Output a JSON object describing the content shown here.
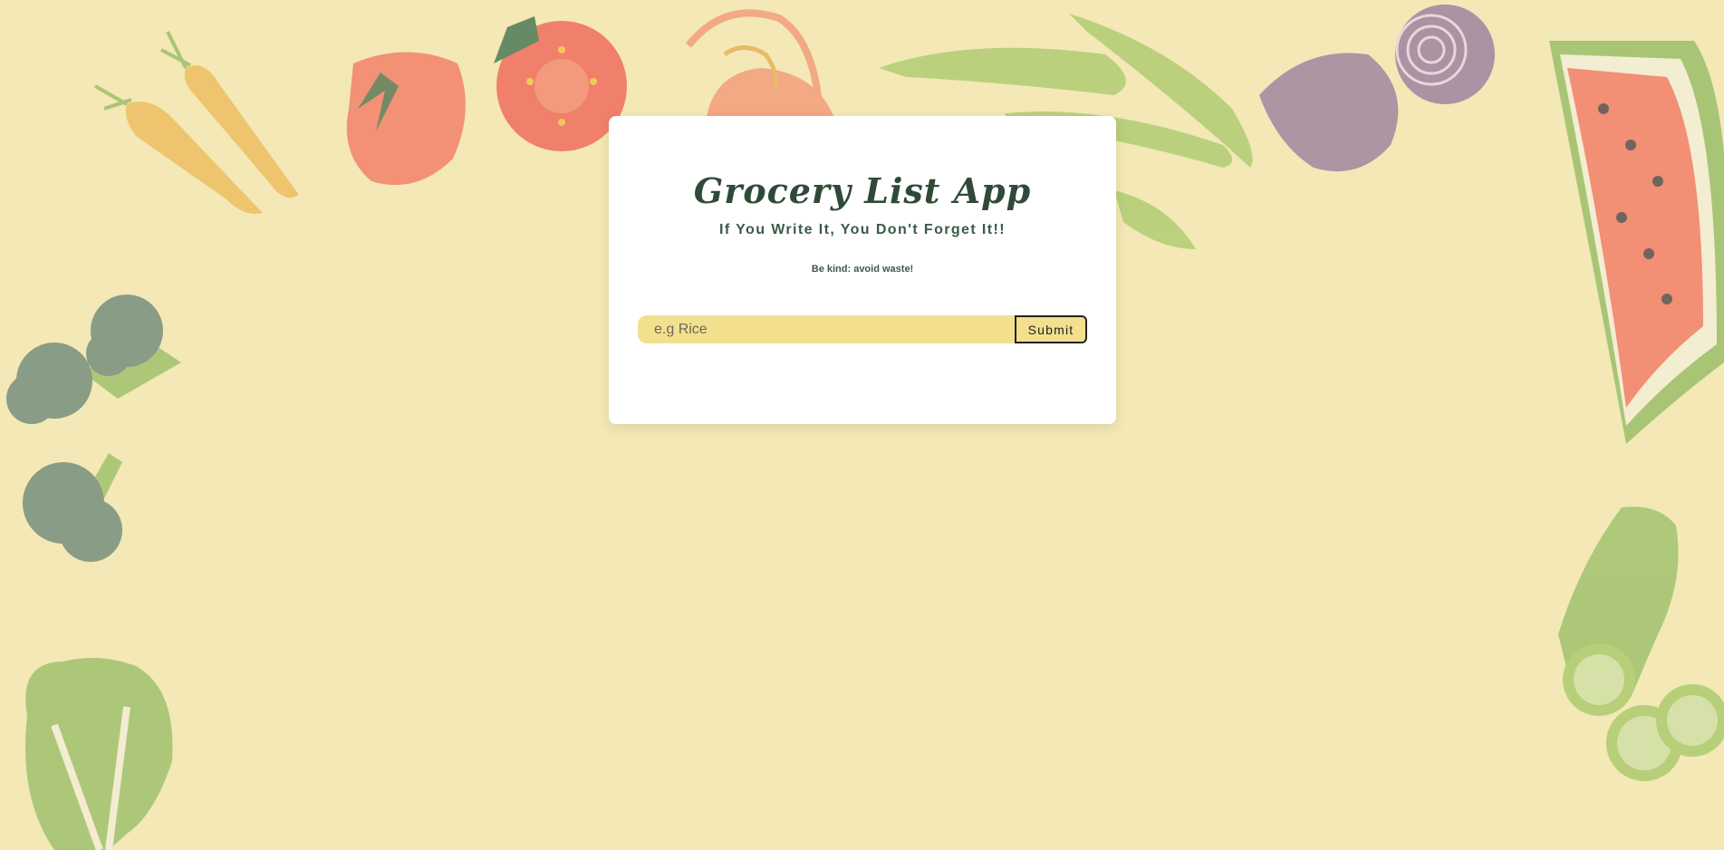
{
  "app": {
    "title": "Grocery List App",
    "subtitle": "If You Write It, You Don't Forget It!!",
    "note": "Be kind: avoid waste!"
  },
  "form": {
    "input_value": "",
    "input_placeholder": "e.g Rice",
    "submit_label": "Submit"
  },
  "colors": {
    "background": "#f3e8b6",
    "card": "#ffffff",
    "heading": "#2f4a38",
    "input_fill": "#f3e08e"
  },
  "decorations": [
    "carrot-icon",
    "tomato-icon",
    "sliced-tomato-icon",
    "pepper-icon",
    "green-bean-icon",
    "onion-icon",
    "sliced-onion-icon",
    "watermelon-icon",
    "broccoli-icon",
    "cucumber-icon",
    "lettuce-icon"
  ]
}
